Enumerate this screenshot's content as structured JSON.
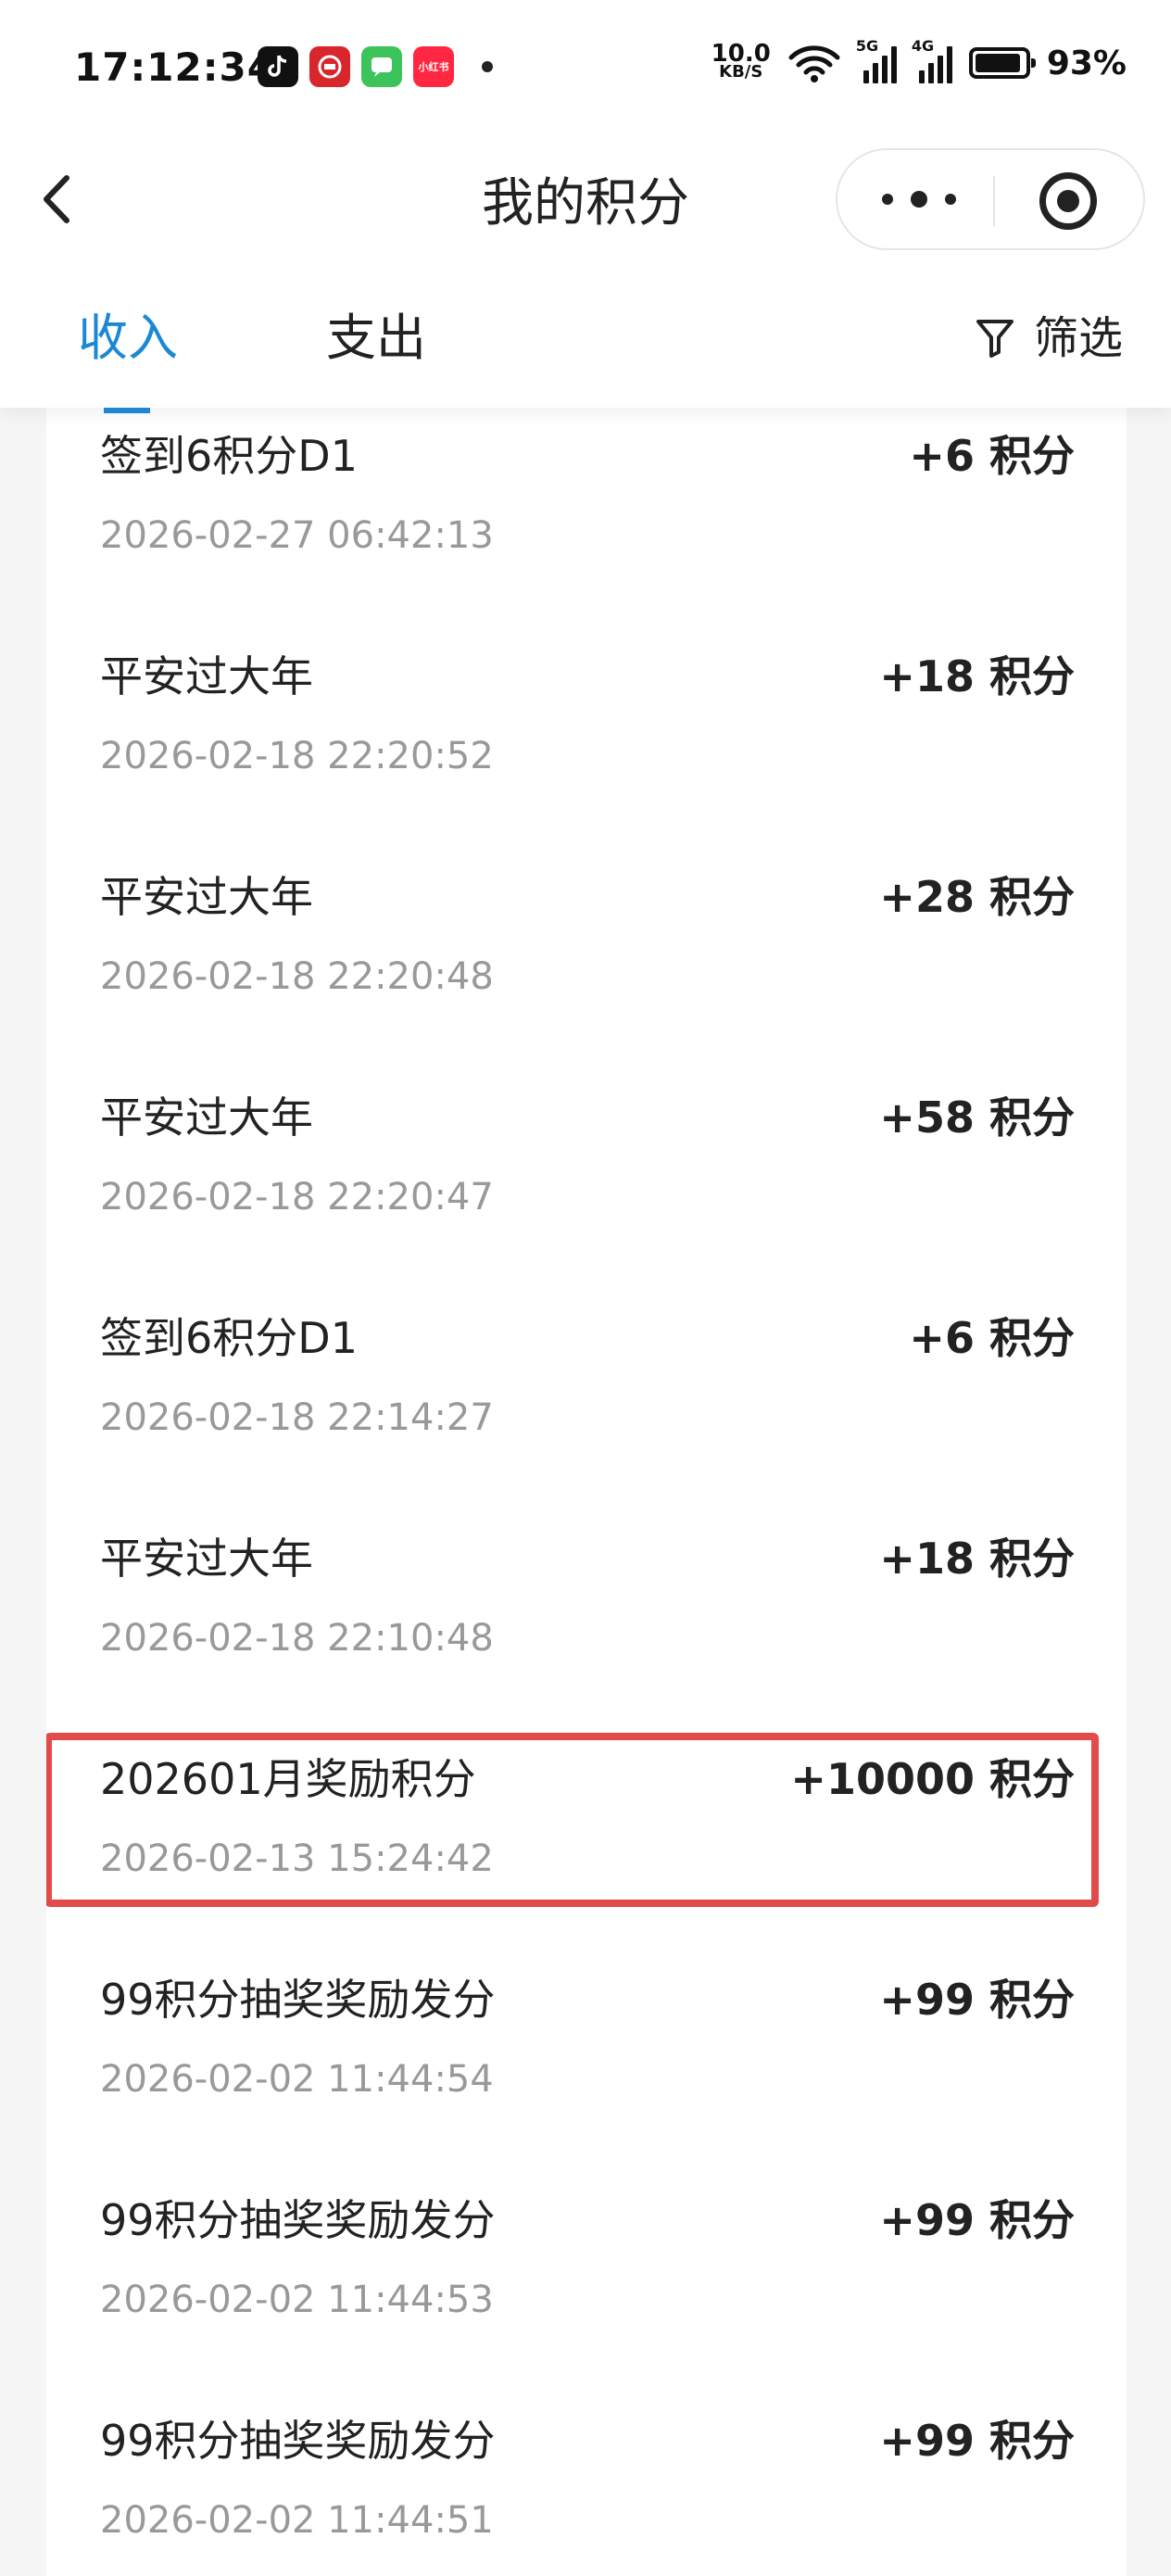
{
  "status_bar": {
    "time": "17:12:34",
    "network_speed_value": "10.0",
    "network_speed_unit": "KB/S",
    "signal_1_label": "5G",
    "signal_2_label": "4G",
    "battery_percent": "93%",
    "battery_level": 0.93,
    "app_icons": [
      {
        "name": "tiktok-icon",
        "color": "#111111"
      },
      {
        "name": "bank-app-icon",
        "color": "#d9262c"
      },
      {
        "name": "messages-icon",
        "color": "#3cc45a"
      },
      {
        "name": "xiaohongshu-icon",
        "color": "#ff2741",
        "text": "小红书"
      }
    ]
  },
  "nav": {
    "back_icon": "chevron-left-icon",
    "title": "我的积分",
    "more_icon": "more-dots-icon",
    "close_icon": "target-circle-icon"
  },
  "tabs": {
    "income": "收入",
    "expense": "支出",
    "active": "income",
    "filter_label": "筛选",
    "filter_icon": "funnel-icon"
  },
  "colors": {
    "accent": "#1b88d6",
    "highlight_border": "#e34b4b",
    "date_text": "#999999"
  },
  "records": [
    {
      "title": "签到6积分D1",
      "date": "2026-02-27 06:42:13",
      "amount": "+6 积分",
      "highlighted": false
    },
    {
      "title": "平安过大年",
      "date": "2026-02-18 22:20:52",
      "amount": "+18 积分",
      "highlighted": false
    },
    {
      "title": "平安过大年",
      "date": "2026-02-18 22:20:48",
      "amount": "+28 积分",
      "highlighted": false
    },
    {
      "title": "平安过大年",
      "date": "2026-02-18 22:20:47",
      "amount": "+58 积分",
      "highlighted": false
    },
    {
      "title": "签到6积分D1",
      "date": "2026-02-18 22:14:27",
      "amount": "+6 积分",
      "highlighted": false
    },
    {
      "title": "平安过大年",
      "date": "2026-02-18 22:10:48",
      "amount": "+18 积分",
      "highlighted": false
    },
    {
      "title": "202601月奖励积分",
      "date": "2026-02-13 15:24:42",
      "amount": "+10000 积分",
      "highlighted": true
    },
    {
      "title": "99积分抽奖奖励发分",
      "date": "2026-02-02 11:44:54",
      "amount": "+99 积分",
      "highlighted": false
    },
    {
      "title": "99积分抽奖奖励发分",
      "date": "2026-02-02 11:44:53",
      "amount": "+99 积分",
      "highlighted": false
    },
    {
      "title": "99积分抽奖奖励发分",
      "date": "2026-02-02 11:44:51",
      "amount": "+99 积分",
      "highlighted": false
    }
  ]
}
